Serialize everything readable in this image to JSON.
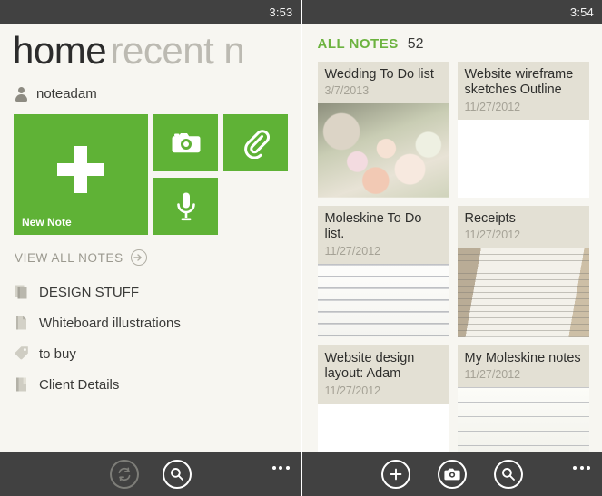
{
  "colors": {
    "accent_green": "#5fb236",
    "header_green": "#6cb33f",
    "page_background": "#f7f6f1",
    "chrome_dark": "#414141",
    "card_header_beige": "#e3e0d4"
  },
  "left": {
    "status_time": "3:53",
    "pivot": {
      "active": "home",
      "inactive": "recent n"
    },
    "account": {
      "name": "noteadam",
      "icon": "person-icon"
    },
    "tiles": [
      {
        "id": "new-note",
        "label": "New Note",
        "icon": "plus-icon"
      },
      {
        "id": "camera",
        "label": "",
        "icon": "camera-icon"
      },
      {
        "id": "attachment",
        "label": "",
        "icon": "paperclip-icon"
      },
      {
        "id": "audio",
        "label": "",
        "icon": "microphone-icon"
      }
    ],
    "view_all": {
      "label": "VIEW ALL NOTES",
      "icon": "arrow-right-circle-icon"
    },
    "notebooks": [
      {
        "label": "DESIGN STUFF",
        "icon": "notebook-stack-icon"
      },
      {
        "label": "Whiteboard illustrations",
        "icon": "page-icon"
      },
      {
        "label": "to buy",
        "icon": "tag-icon"
      },
      {
        "label": "Client Details",
        "icon": "notebook-icon"
      }
    ],
    "appbar": {
      "buttons": [
        {
          "id": "sync",
          "icon": "sync-icon",
          "state": "disabled"
        },
        {
          "id": "search",
          "icon": "search-icon",
          "state": "enabled"
        }
      ],
      "overflow": {
        "icon": "ellipsis-icon",
        "label": "..."
      }
    }
  },
  "right": {
    "status_time": "3:54",
    "header": {
      "title": "ALL NOTES",
      "count": "52"
    },
    "notes": [
      {
        "title": "Wedding To Do list",
        "date": "3/7/2013",
        "thumb": "ph-flowers",
        "height": "h-150"
      },
      {
        "title": "Website wireframe sketches Outline",
        "date": "11/27/2012",
        "thumb": "",
        "height": "h-150"
      },
      {
        "title": "Moleskine To Do list.",
        "date": "11/27/2012",
        "thumb": "ph-sketch",
        "height": "h-145"
      },
      {
        "title": "Receipts",
        "date": "11/27/2012",
        "thumb": "ph-receipt",
        "height": "h-145"
      },
      {
        "title": "Website design layout: Adam",
        "date": "11/27/2012",
        "thumb": "",
        "height": "h-120"
      },
      {
        "title": "My Moleskine notes",
        "date": "11/27/2012",
        "thumb": "ph-sketch2",
        "height": "h-120"
      }
    ],
    "appbar": {
      "buttons": [
        {
          "id": "new-note",
          "icon": "plus-icon",
          "state": "enabled"
        },
        {
          "id": "camera",
          "icon": "camera-icon",
          "state": "enabled"
        },
        {
          "id": "search",
          "icon": "search-icon",
          "state": "enabled"
        }
      ],
      "overflow": {
        "icon": "ellipsis-icon",
        "label": "..."
      }
    }
  }
}
